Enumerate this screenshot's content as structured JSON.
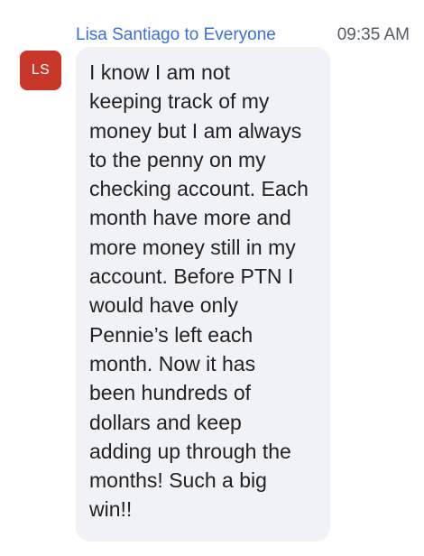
{
  "message": {
    "sender": "Lisa Santiago",
    "to_word": "to",
    "recipient": "Everyone",
    "time": "09:35 AM",
    "avatar_initials": "LS",
    "avatar_color": "#c7382b",
    "name_color": "#3a6fd8",
    "bubble_color": "#f1f2f8",
    "text": "I know I am not\nkeeping track of my\nmoney but I am always\nto the penny on my\nchecking account. Each\nmonth have more and\nmore money still in my\naccount. Before PTN I\nwould have only\nPennie’s left each\nmonth. Now it has\nbeen hundreds of\ndollars and keep\nadding up through the\nmonths! Such a big\nwin!!"
  }
}
